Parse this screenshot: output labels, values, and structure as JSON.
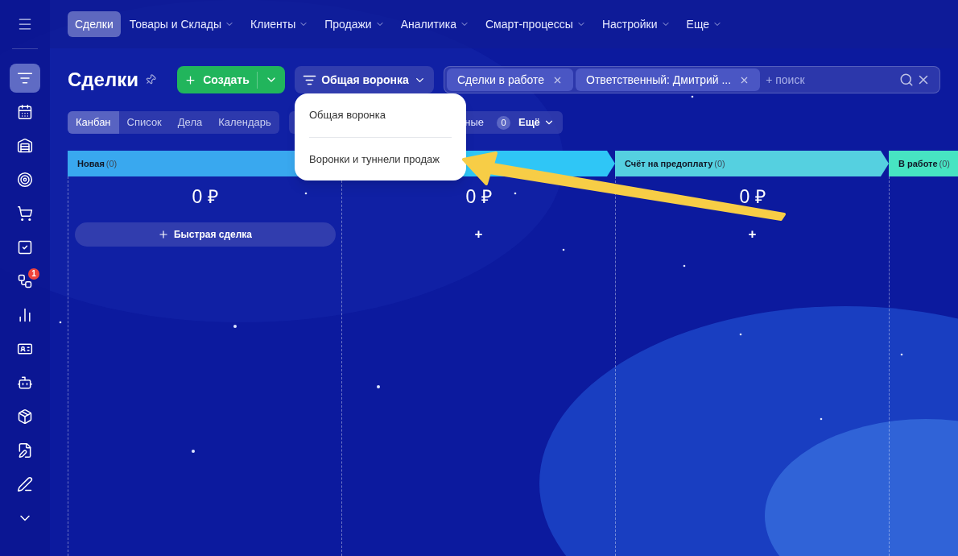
{
  "top_nav": [
    {
      "label": "Сделки",
      "selected": true,
      "dropdown": false
    },
    {
      "label": "Товары и Склады",
      "selected": false,
      "dropdown": true
    },
    {
      "label": "Клиенты",
      "selected": false,
      "dropdown": true
    },
    {
      "label": "Продажи",
      "selected": false,
      "dropdown": true
    },
    {
      "label": "Аналитика",
      "selected": false,
      "dropdown": true
    },
    {
      "label": "Смарт-процессы",
      "selected": false,
      "dropdown": true
    },
    {
      "label": "Настройки",
      "selected": false,
      "dropdown": true
    },
    {
      "label": "Еще",
      "selected": false,
      "dropdown": true
    }
  ],
  "sidebar": [
    {
      "selected": true
    },
    {
      "selected": false
    },
    {
      "selected": false
    },
    {
      "selected": false
    },
    {
      "selected": false
    },
    {
      "selected": false
    },
    {
      "selected": false,
      "badge": "1"
    },
    {
      "selected": false
    },
    {
      "selected": false
    },
    {
      "selected": false
    },
    {
      "selected": false
    },
    {
      "selected": false
    },
    {
      "selected": false
    },
    {
      "selected": false
    }
  ],
  "page_title": "Сделки",
  "create_button": "Создать",
  "funnel_button": "Общая воронка",
  "filter": {
    "tags": [
      "Сделки в работе",
      "Ответственный: Дмитрий ..."
    ],
    "placeholder": "+ поиск"
  },
  "views": [
    {
      "label": "Канбан",
      "selected": true
    },
    {
      "label": "Список",
      "selected": false
    },
    {
      "label": "Дела",
      "selected": false
    },
    {
      "label": "Календарь",
      "selected": false
    }
  ],
  "counters": {
    "label": "ные",
    "count": "0",
    "more": "Ещё"
  },
  "funnel_menu": [
    {
      "label": "Общая воронка"
    },
    {
      "label": "Воронки и туннели продаж"
    }
  ],
  "columns": [
    {
      "title": "Новая",
      "count": "(0)",
      "color": "#39a8ef",
      "sum": "0 ₽",
      "kind": "quick",
      "quick_label": "Быстрая сделка"
    },
    {
      "color": "#2fc6f6",
      "sum": "0 ₽",
      "kind": "plus",
      "plus": "+"
    },
    {
      "title": "Счёт на предоплату",
      "count": "(0)",
      "color": "#55d0e0",
      "sum": "0 ₽",
      "kind": "plus",
      "plus": "+"
    },
    {
      "title": "В работе",
      "count": "(0)",
      "color": "#47e4c2",
      "kind": "none"
    }
  ]
}
